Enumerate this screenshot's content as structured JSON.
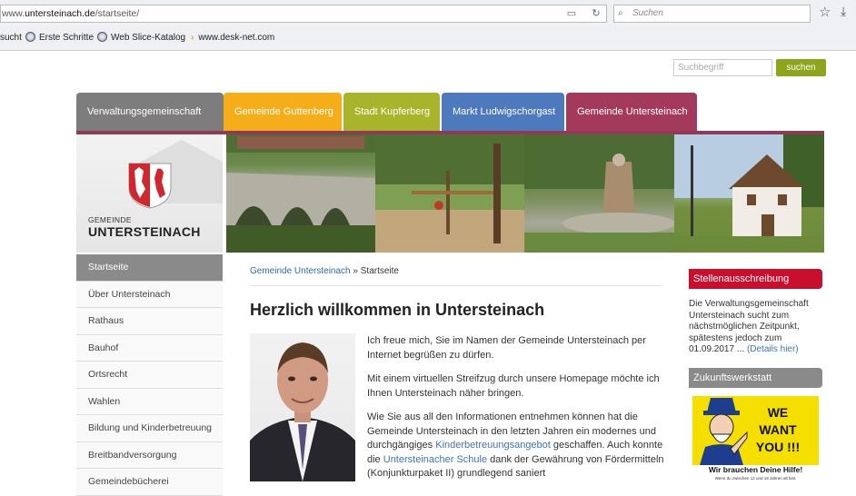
{
  "browser": {
    "url_prefix": "www.",
    "url_host": "untersteinach.de",
    "url_path": "/startseite/",
    "search_placeholder": "Suchen",
    "favorites": [
      {
        "label": "sucht",
        "icon": "none"
      },
      {
        "label": "Erste Schritte",
        "icon": "globe-icon"
      },
      {
        "label": "Web Slice-Katalog",
        "icon": "globe-icon"
      },
      {
        "label": "www.desk-net.com",
        "icon": "chevron-icon"
      }
    ]
  },
  "site_search": {
    "placeholder": "Suchbegriff",
    "button_label": "suchen",
    "button_color": "#8da51b"
  },
  "nav_tabs": [
    {
      "label": "Verwaltungsgemeinschaft",
      "color": "#7d7d7d"
    },
    {
      "label": "Gemeinde Guttenberg",
      "color": "#f5ad1a"
    },
    {
      "label": "Stadt Kupferberg",
      "color": "#a8b52a"
    },
    {
      "label": "Markt Ludwigschorgast",
      "color": "#4d79bd"
    },
    {
      "label": "Gemeinde Untersteinach",
      "color": "#a33a5c"
    }
  ],
  "logo": {
    "small": "GEMEINDE",
    "big": "UNTERSTEINACH"
  },
  "sidebar": {
    "items": [
      {
        "label": "Startseite",
        "active": true
      },
      {
        "label": "Über Untersteinach"
      },
      {
        "label": "Rathaus"
      },
      {
        "label": "Bauhof"
      },
      {
        "label": "Ortsrecht"
      },
      {
        "label": "Wahlen"
      },
      {
        "label": "Bildung und Kinderbetreuung"
      },
      {
        "label": "Breitbandversorgung"
      },
      {
        "label": "Gemeindebücherei"
      }
    ]
  },
  "main": {
    "breadcrumb_link": "Gemeinde Untersteinach",
    "breadcrumb_sep": " » ",
    "breadcrumb_current": "Startseite",
    "title": "Herzlich willkommen in Untersteinach",
    "p1": "Ich freue mich, Sie im Namen der Gemeinde Untersteinach per Internet begrüßen zu dürfen.",
    "p2": "Mit einem virtuellen Streifzug durch unsere Homepage möchte ich Ihnen Untersteinach näher bringen.",
    "p3_a": "Wie Sie aus all den Informationen entnehmen können hat die Gemeinde Untersteinach in den letzten Jahren ein modernes und durchgängiges ",
    "p3_link1": "Kinderbetreuungsangebot",
    "p3_b": " geschaffen. Auch konnte die ",
    "p3_link2": "Untersteinacher Schule",
    "p3_c": " dank der Gewährung von Fördermitteln (Konjunkturpaket II) grundlegend saniert"
  },
  "right": {
    "box1_title": "Stellenausschreibung",
    "box1_color": "#c8102e",
    "box1_text": "Die Verwaltungsgemeinschaft Untersteinach sucht zum nächstmöglichen Zeitpunkt, spätestens jedoch zum 01.09.2017 ... ",
    "box1_link": "(Details hier)",
    "box2_title": "Zukunftswerkstatt",
    "box2_color": "#8a8a8a",
    "poster_line1": "WE",
    "poster_line2": "WANT",
    "poster_line3": "YOU !!!",
    "poster_sub": "Wir brauchen Deine Hilfe!",
    "poster_sub2": "Wenn du zwischen 12 und 18 Jahren alt bist."
  }
}
